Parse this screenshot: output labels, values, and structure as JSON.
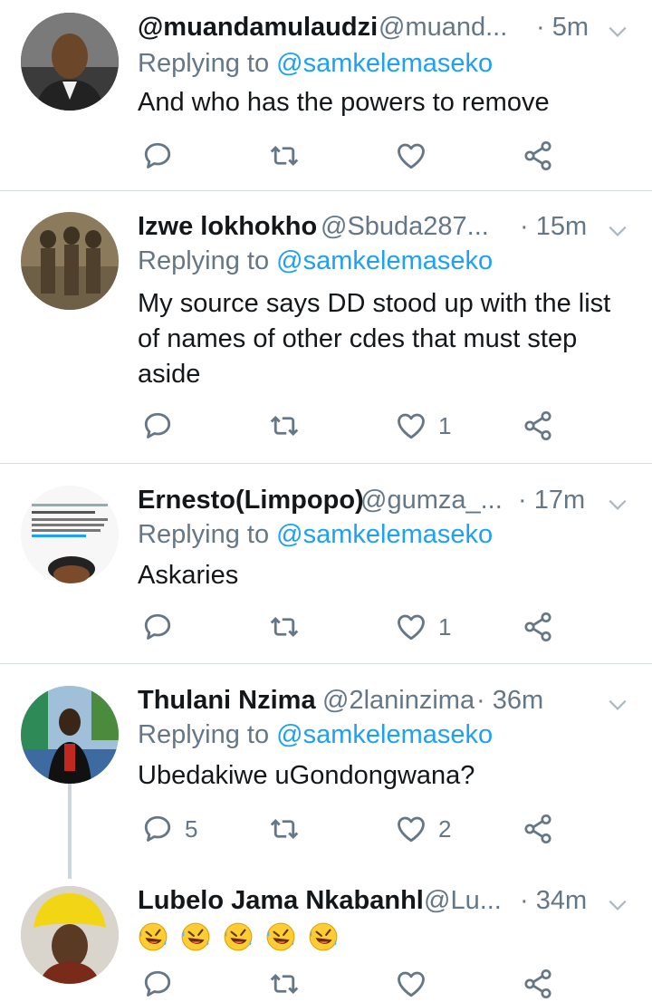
{
  "tweets": [
    {
      "name": "@muandamulaudzi",
      "handle": "@muand...",
      "time": "· 5m",
      "replying_label": "Replying to",
      "replying_to": "@samkelemaseko",
      "text": "And who has the powers to remove",
      "replies": "",
      "retweets": "",
      "likes": ""
    },
    {
      "name": "Izwe lokhokho",
      "handle": "@Sbuda287...",
      "time": "· 15m",
      "replying_label": "Replying to",
      "replying_to": "@samkelemaseko",
      "text": "My source says DD stood up with the list of names of other cdes that must step aside",
      "replies": "",
      "retweets": "",
      "likes": "1"
    },
    {
      "name": "Ernesto(Limpopo)",
      "handle": "@gumza_...",
      "time": "· 17m",
      "replying_label": "Replying to",
      "replying_to": "@samkelemaseko",
      "text": "Askaries",
      "replies": "",
      "retweets": "",
      "likes": "1"
    },
    {
      "name": "Thulani Nzima",
      "handle": "@2laninzima",
      "time": "· 36m",
      "replying_label": "Replying to",
      "replying_to": "@samkelemaseko",
      "text": "Ubedakiwe uGondongwana?",
      "replies": "5",
      "retweets": "",
      "likes": "2"
    },
    {
      "name": "Lubelo Jama Nkabanhl",
      "handle": "@Lu...",
      "time": "· 34m",
      "text": "🤣🤣🤣🤣🤣",
      "replies": "",
      "retweets": "",
      "likes": ""
    }
  ],
  "icons": {
    "reply": "reply-icon",
    "retweet": "retweet-icon",
    "like": "heart-icon",
    "share": "share-icon",
    "menu": "chevron-down-icon",
    "emoji": "rolling-on-floor-laughing-emoji"
  },
  "colors": {
    "link": "#1da1f2",
    "secondary_text": "#657786",
    "primary_text": "#14171a",
    "divider": "#d6dce1"
  }
}
